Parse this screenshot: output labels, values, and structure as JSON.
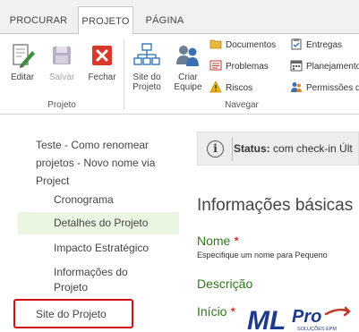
{
  "ribbon": {
    "tabs": [
      {
        "label": "PROCURAR",
        "active": false
      },
      {
        "label": "PROJETO",
        "active": true
      },
      {
        "label": "PÁGINA",
        "active": false
      }
    ],
    "groups": {
      "projeto": {
        "label": "Projeto",
        "buttons": [
          {
            "label": "Editar",
            "icon": "edit-icon",
            "enabled": true
          },
          {
            "label": "Salvar",
            "icon": "save-icon",
            "enabled": false
          },
          {
            "label": "Fechar",
            "icon": "close-icon",
            "enabled": true
          }
        ]
      },
      "navegar": {
        "label": "Navegar",
        "big_buttons": [
          {
            "label": "Site do\nProjeto",
            "icon": "sitemap-icon"
          },
          {
            "label": "Criar\nEquipe",
            "icon": "team-icon"
          }
        ],
        "small_buttons": [
          {
            "label": "Documentos",
            "icon": "folder-icon"
          },
          {
            "label": "Problemas",
            "icon": "list-icon"
          },
          {
            "label": "Riscos",
            "icon": "warning-icon"
          },
          {
            "label": "Entregas",
            "icon": "box-icon"
          },
          {
            "label": "Planejamento",
            "icon": "calendar-icon"
          },
          {
            "label": "Permissões do",
            "icon": "users-icon"
          }
        ]
      }
    }
  },
  "nav": {
    "header": "Teste - Como renomear projetos - Novo nome via Project",
    "items": [
      {
        "label": "Cronograma",
        "selected": false
      },
      {
        "label": "Detalhes do Projeto",
        "selected": true
      },
      {
        "label": "Impacto Estratégico",
        "selected": false
      },
      {
        "label": "Informações do Projeto",
        "selected": false
      },
      {
        "label": "Site do Projeto",
        "selected": false,
        "highlighted": true
      }
    ]
  },
  "status": {
    "icon": "info-icon",
    "label": "Status:",
    "text": "com check-in Últ"
  },
  "main": {
    "section_title": "Informações básicas",
    "fields": [
      {
        "label": "Nome",
        "required": true,
        "description": "Especifique um nome para Pequeno"
      },
      {
        "label": "Descrição",
        "required": false
      },
      {
        "label": "Início",
        "required": true
      }
    ]
  },
  "watermark": {
    "brand": "MLPro",
    "tagline": "SOLUÇÕES EPM"
  },
  "colors": {
    "field_label": "#2c7a1a",
    "required_star": "#cc0000",
    "selected_nav_bg": "#eaf6e1",
    "highlight_box": "#d11111",
    "status_bg": "#ededed"
  }
}
